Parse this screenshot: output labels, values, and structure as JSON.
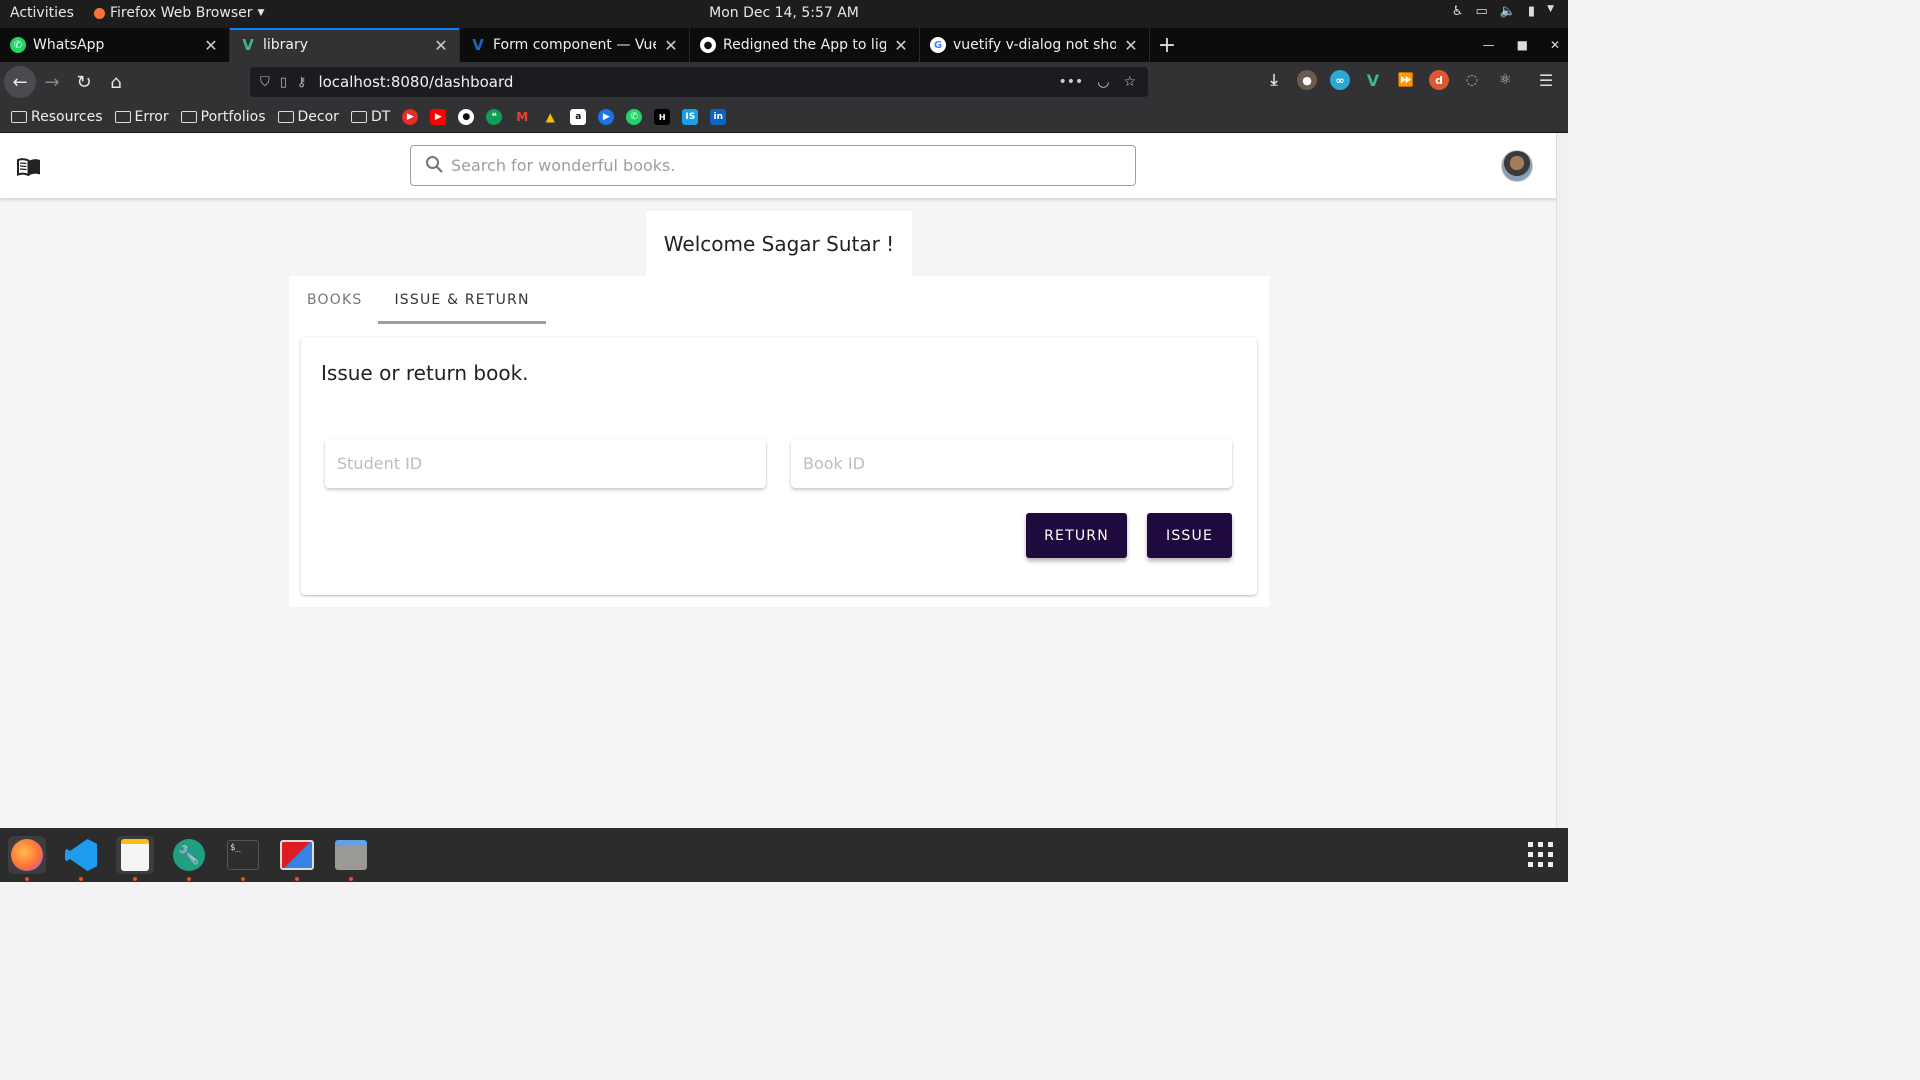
{
  "os_bar": {
    "activities": "Activities",
    "app_menu": "Firefox Web Browser",
    "clock": "Mon Dec 14,  5:57 AM"
  },
  "browser": {
    "tabs": [
      {
        "title": "WhatsApp",
        "favicon": "whatsapp-icon",
        "active": false
      },
      {
        "title": "library",
        "favicon": "vue-icon",
        "active": true
      },
      {
        "title": "Form component — Vuet",
        "favicon": "vuetify-icon",
        "active": false
      },
      {
        "title": "Redigned the App to ligh",
        "favicon": "github-icon",
        "active": false
      },
      {
        "title": "vuetify v-dialog not show",
        "favicon": "google-icon",
        "active": false
      }
    ],
    "url": "localhost:8080/dashboard",
    "bookmarks": [
      "Resources",
      "Error",
      "Portfolios",
      "Decor",
      "DT"
    ]
  },
  "app": {
    "search_placeholder": "Search for wonderful books.",
    "welcome": "Welcome Sagar Sutar !",
    "tabs": [
      "BOOKS",
      "ISSUE & RETURN"
    ],
    "active_tab": "ISSUE & RETURN",
    "form": {
      "title": "Issue or return book.",
      "student_placeholder": "Student ID",
      "book_placeholder": "Book ID",
      "return_label": "RETURN",
      "issue_label": "ISSUE"
    }
  },
  "colors": {
    "primary_button": "#1e0a3c",
    "firefox_accent": "#0a84ff",
    "ubuntu_accent": "#e95420"
  }
}
